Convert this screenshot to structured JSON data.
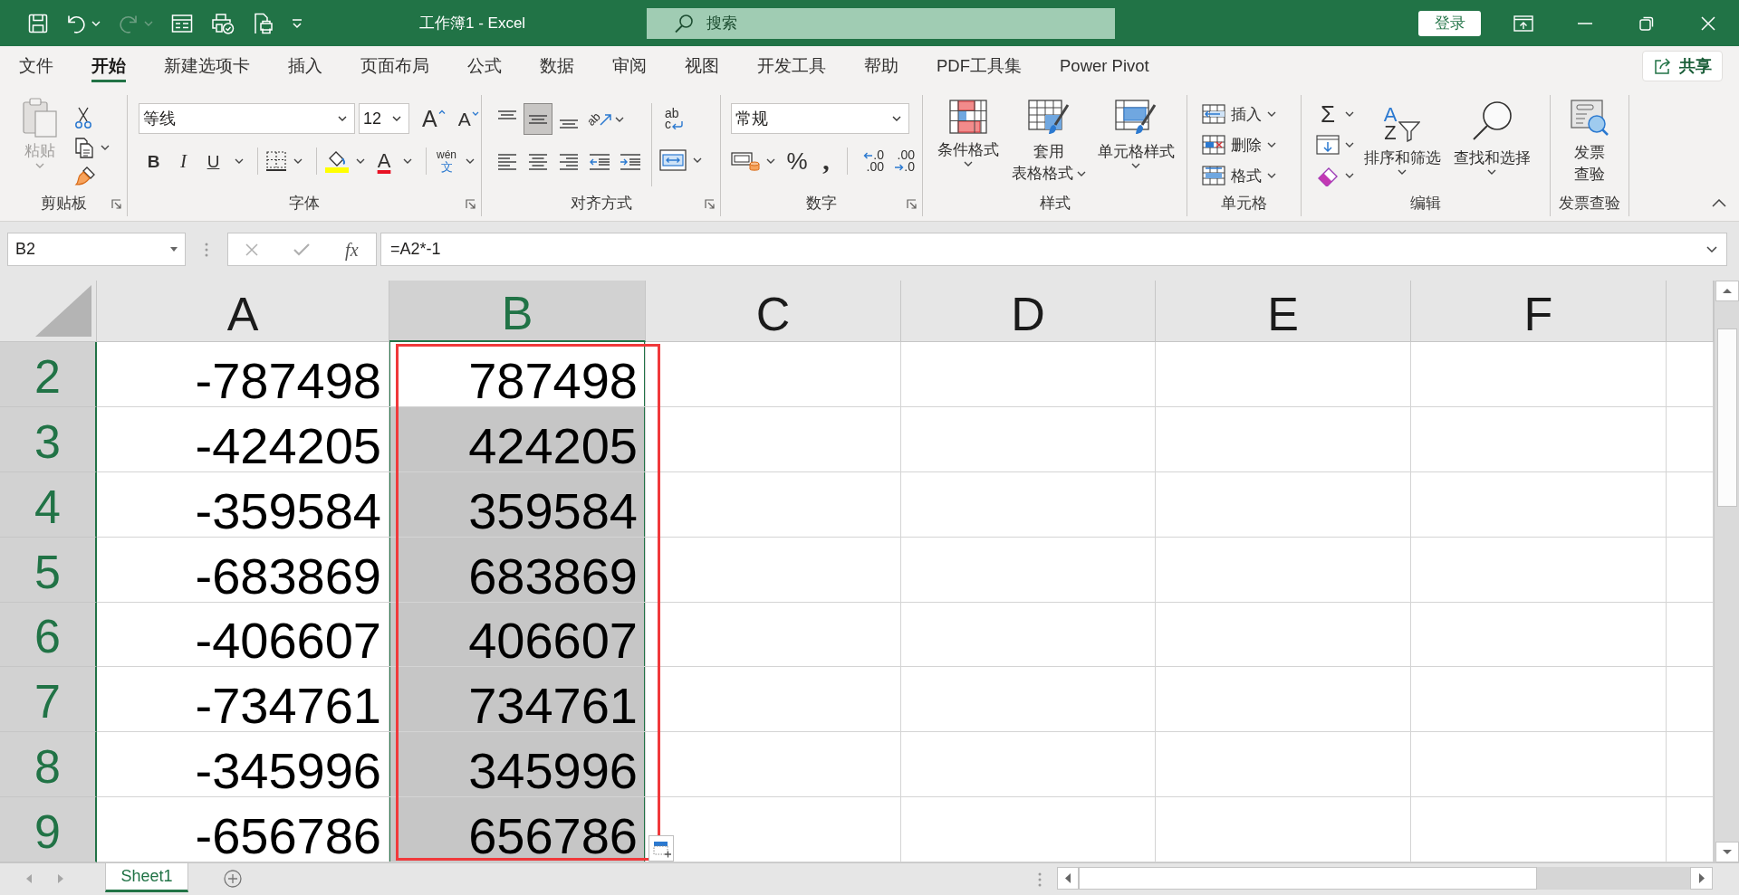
{
  "window": {
    "title": "工作簿1 - Excel",
    "search_placeholder": "搜索",
    "sign_in": "登录"
  },
  "quick_access": [
    {
      "kind": "save",
      "disabled": false
    },
    {
      "kind": "undo",
      "disabled": false
    },
    {
      "kind": "redo",
      "disabled": true
    },
    {
      "kind": "form",
      "disabled": false
    },
    {
      "kind": "print_preview",
      "disabled": false
    },
    {
      "kind": "page_print",
      "disabled": false
    },
    {
      "kind": "customize",
      "disabled": false
    }
  ],
  "tabs": [
    {
      "label": "文件",
      "selected": false
    },
    {
      "label": "开始",
      "selected": true
    },
    {
      "label": "新建选项卡",
      "selected": false
    },
    {
      "label": "插入",
      "selected": false
    },
    {
      "label": "页面布局",
      "selected": false
    },
    {
      "label": "公式",
      "selected": false
    },
    {
      "label": "数据",
      "selected": false
    },
    {
      "label": "审阅",
      "selected": false
    },
    {
      "label": "视图",
      "selected": false
    },
    {
      "label": "开发工具",
      "selected": false
    },
    {
      "label": "帮助",
      "selected": false
    },
    {
      "label": "PDF工具集",
      "selected": false
    },
    {
      "label": "Power Pivot",
      "selected": false
    }
  ],
  "share": "共享",
  "ribbon": {
    "clipboard": {
      "label": "剪贴板",
      "paste": {
        "label": "粘贴",
        "disabled": true
      }
    },
    "font": {
      "label": "字体",
      "name": "等线",
      "size": "12",
      "grow": "A",
      "shrink": "A",
      "bold": "B",
      "italic": "I",
      "underline": "U",
      "font_color": "A",
      "phonetic": [
        "wén",
        "文"
      ]
    },
    "alignment": {
      "label": "对齐方式",
      "vertical": [
        {
          "selected": false
        },
        {
          "selected": true
        },
        {
          "selected": false
        }
      ],
      "orientation": "ab",
      "wrap": [
        "ab",
        "c"
      ]
    },
    "number": {
      "label": "数字",
      "format": "常规",
      "percent": "%",
      "comma": ",",
      "increase_decimal": [
        ".0",
        ".00"
      ],
      "decrease_decimal": [
        ".00",
        ".0"
      ]
    },
    "styles": {
      "label": "样式",
      "items": [
        {
          "kind": "conditional",
          "lines": [
            "条件格式"
          ]
        },
        {
          "kind": "table",
          "lines": [
            "套用",
            "表格格式"
          ]
        },
        {
          "kind": "cell",
          "lines": [
            "单元格样式"
          ]
        }
      ]
    },
    "cells": {
      "label": "单元格",
      "items": [
        {
          "kind": "insert",
          "label": "插入"
        },
        {
          "kind": "delete",
          "label": "删除"
        },
        {
          "kind": "format",
          "label": "格式"
        }
      ]
    },
    "editing": {
      "label": "编辑",
      "sum": "Σ",
      "sort": {
        "letters": [
          "A",
          "Z"
        ],
        "label": "排序和筛选"
      },
      "find": "查找和选择"
    },
    "invoice": {
      "label": "发票查验",
      "lines": [
        "发票",
        "查验"
      ]
    }
  },
  "formula_bar": {
    "name_box": "B2",
    "fx": "fx",
    "formula": "=A2*-1"
  },
  "sheet": {
    "columns": [
      {
        "label": "A",
        "selected": false,
        "framed": false
      },
      {
        "label": "B",
        "selected": true,
        "framed": true
      },
      {
        "label": "C",
        "selected": false,
        "framed": false
      },
      {
        "label": "D",
        "selected": false,
        "framed": false
      },
      {
        "label": "E",
        "selected": false,
        "framed": false
      },
      {
        "label": "F",
        "selected": false,
        "framed": false
      }
    ],
    "rows": [
      {
        "label": "2",
        "selected": true,
        "cells": [
          {
            "value": "-787498",
            "selected": false
          },
          {
            "value": "787498",
            "selected": true,
            "active": true
          }
        ]
      },
      {
        "label": "3",
        "selected": true,
        "cells": [
          {
            "value": "-424205",
            "selected": false
          },
          {
            "value": "424205",
            "selected": true,
            "active": false
          }
        ]
      },
      {
        "label": "4",
        "selected": true,
        "cells": [
          {
            "value": "-359584",
            "selected": false
          },
          {
            "value": "359584",
            "selected": true,
            "active": false
          }
        ]
      },
      {
        "label": "5",
        "selected": true,
        "cells": [
          {
            "value": "-683869",
            "selected": false
          },
          {
            "value": "683869",
            "selected": true,
            "active": false
          }
        ]
      },
      {
        "label": "6",
        "selected": true,
        "cells": [
          {
            "value": "-406607",
            "selected": false
          },
          {
            "value": "406607",
            "selected": true,
            "active": false
          }
        ]
      },
      {
        "label": "7",
        "selected": true,
        "cells": [
          {
            "value": "-734761",
            "selected": false
          },
          {
            "value": "734761",
            "selected": true,
            "active": false
          }
        ]
      },
      {
        "label": "8",
        "selected": true,
        "cells": [
          {
            "value": "-345996",
            "selected": false
          },
          {
            "value": "345996",
            "selected": true,
            "active": false
          }
        ]
      },
      {
        "label": "9",
        "selected": true,
        "cells": [
          {
            "value": "-656786",
            "selected": false
          },
          {
            "value": "656786",
            "selected": true,
            "active": false
          }
        ]
      }
    ]
  },
  "sheet_tabs": [
    {
      "label": "Sheet1",
      "selected": true
    }
  ]
}
